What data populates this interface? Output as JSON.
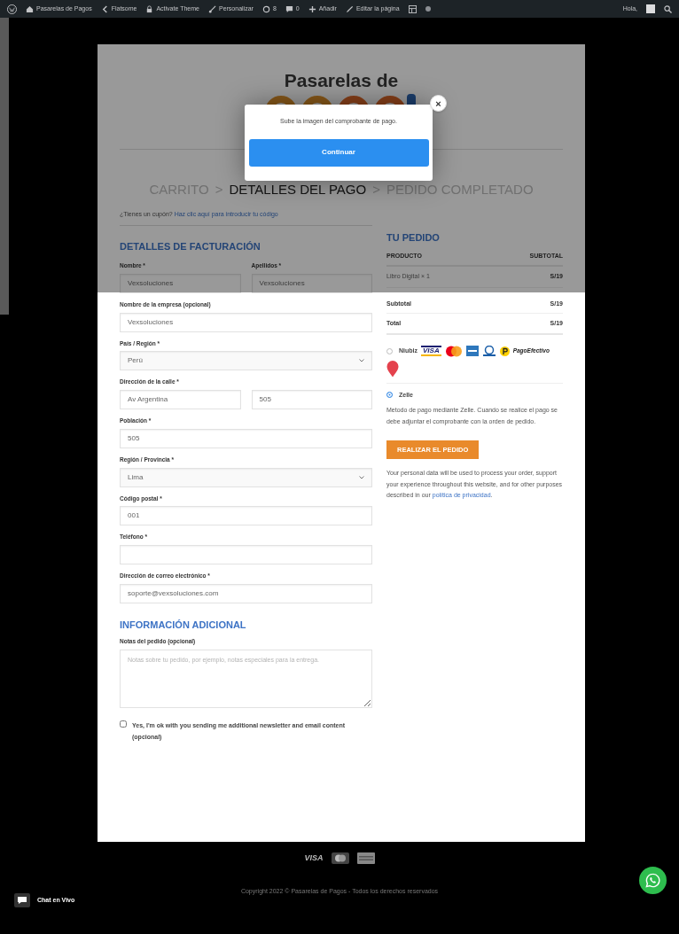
{
  "admin_bar": {
    "items": [
      {
        "kind": "site",
        "label": "Pasarelas de Pagos"
      },
      {
        "kind": "theme",
        "label": "Flatsome"
      },
      {
        "kind": "lock",
        "label": "Activate Theme"
      },
      {
        "kind": "brush",
        "label": "Personalizar"
      },
      {
        "kind": "updates",
        "label": "8"
      },
      {
        "kind": "comments",
        "label": "0"
      },
      {
        "kind": "add",
        "label": "Añadir"
      },
      {
        "kind": "edit",
        "label": "Editar la página"
      }
    ],
    "greeting": "Hola,"
  },
  "logo": {
    "text": "Pasarelas de"
  },
  "modal": {
    "message": "Sube la imagen del comprobante de pago.",
    "button": "Continuar",
    "close": "×"
  },
  "breadcrumb": {
    "separator": ">",
    "steps": [
      {
        "label": "CARRITO",
        "selected": false
      },
      {
        "label": "DETALLES DEL PAGO",
        "selected": true
      },
      {
        "label": "PEDIDO COMPLETADO",
        "selected": false
      }
    ]
  },
  "coupon": {
    "text": "¿Tienes un cupón?",
    "link": "Haz clic aquí para introducir tu código"
  },
  "billing": {
    "title": "DETALLES DE FACTURACIÓN",
    "rows": [
      {
        "cells": [
          {
            "label": "Nombre *",
            "kind": "text",
            "value": "Vexsoluciones"
          },
          {
            "label": "Apellidos *",
            "kind": "text",
            "value": "Vexsoluciones"
          }
        ]
      },
      {
        "label": "Nombre de la empresa (opcional)",
        "cells": [
          {
            "kind": "text",
            "value": "Vexsoluciones"
          }
        ]
      },
      {
        "label": "País / Región *",
        "cells": [
          {
            "kind": "select",
            "value": "Perú"
          }
        ]
      },
      {
        "label": "Dirección de la calle *",
        "cells": [
          {
            "kind": "text",
            "value": "Av Argentina"
          },
          {
            "kind": "text",
            "value": "505"
          }
        ]
      },
      {
        "label": "Población *",
        "cells": [
          {
            "kind": "text",
            "value": "505"
          }
        ]
      },
      {
        "label": "Región / Provincia *",
        "cells": [
          {
            "kind": "select",
            "value": "Lima"
          }
        ]
      },
      {
        "label": "Código postal *",
        "cells": [
          {
            "kind": "text",
            "value": "001"
          }
        ]
      },
      {
        "label": "Teléfono *",
        "cells": [
          {
            "kind": "text"
          }
        ]
      },
      {
        "label": "Dirección de correo electrónico *",
        "cells": [
          {
            "kind": "text",
            "value": "soporte@vexsoluciones.com"
          }
        ]
      }
    ]
  },
  "additional": {
    "title": "INFORMACIÓN ADICIONAL",
    "label": "Notas del pedido (opcional)",
    "placeholder": "Notas sobre tu pedido, por ejemplo, notas especiales para la entrega."
  },
  "newsletter": {
    "label": "Yes, I'm ok with you sending me additional newsletter and email content (opcional)",
    "checked": false
  },
  "order": {
    "title": "TU PEDIDO",
    "columns": [
      "PRODUCTO",
      "SUBTOTAL"
    ],
    "items": [
      {
        "name": "Libro Digital × 1",
        "total": "S/19"
      }
    ],
    "totals": [
      {
        "label": "Subtotal",
        "value": "S/19"
      },
      {
        "label": "Total",
        "value": "S/19"
      }
    ]
  },
  "payment_methods": [
    {
      "kind": "cards",
      "label": "Niubiz",
      "selected": false,
      "wordmark": "PagoEfectivo",
      "card_label": "VISA"
    },
    {
      "kind": "plain",
      "label": "Zelle",
      "selected": true,
      "description": "Metodo de pago mediante Zelle. Cuando se realice el pago se debe adjuntar el comprobante con la orden de pedido."
    }
  ],
  "place_order": "REALIZAR EL PEDIDO",
  "privacy": {
    "text": "Your personal data will be used to process your order, support your experience throughout this website, and for other purposes described in our ",
    "link": "política de privacidad",
    "end": "."
  },
  "footer": {
    "card_label": "VISA",
    "copyright": "Copyright 2022 © Pasarelas de Pagos - Todos los derechos reservados"
  },
  "chat": {
    "label": "Chat en Vivo"
  }
}
